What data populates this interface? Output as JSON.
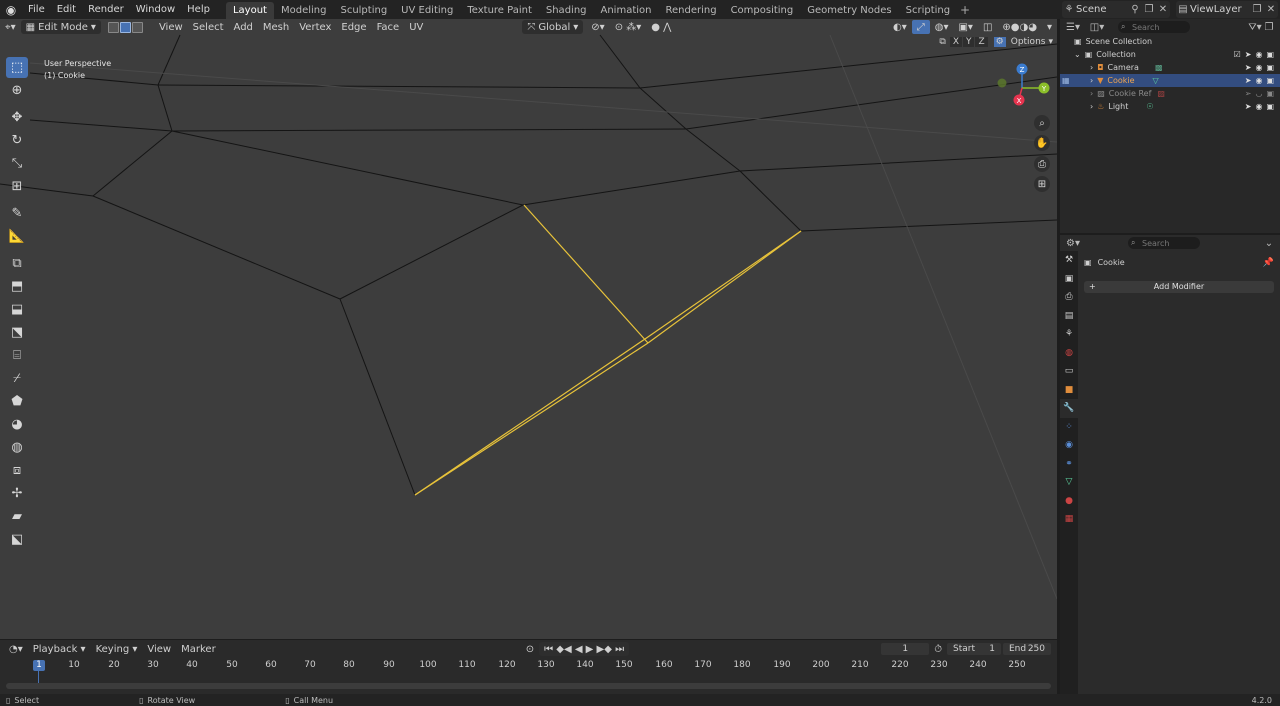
{
  "app": {
    "menu": [
      "File",
      "Edit",
      "Render",
      "Window",
      "Help"
    ],
    "workspaces": [
      "Layout",
      "Modeling",
      "Sculpting",
      "UV Editing",
      "Texture Paint",
      "Shading",
      "Animation",
      "Rendering",
      "Compositing",
      "Geometry Nodes",
      "Scripting"
    ],
    "active_workspace": "Layout",
    "scene": "Scene",
    "view_layer": "ViewLayer",
    "version": "4.2.0"
  },
  "viewport": {
    "mode": "Edit Mode",
    "menu": [
      "View",
      "Select",
      "Add",
      "Mesh",
      "Vertex",
      "Edge",
      "Face",
      "UV"
    ],
    "orientation": "Global",
    "perspective": "User Perspective",
    "object_label": "(1) Cookie",
    "options": "Options",
    "axes": [
      "X",
      "Y",
      "Z"
    ],
    "gizmo": {
      "x": "X",
      "y": "Y",
      "z": "Z"
    },
    "colors": {
      "background": "#3d3d3d",
      "edge": "#111111",
      "selected_edge": "#e8c33a",
      "active": "#4772b3"
    }
  },
  "toolbar": {
    "tools": [
      "select-box-icon",
      "cursor-icon",
      "move-icon",
      "rotate-icon",
      "scale-icon",
      "transform-icon",
      "annotate-icon",
      "measure-icon",
      "add-cube-icon",
      "extrude-icon",
      "inset-icon",
      "bevel-icon",
      "loop-cut-icon",
      "knife-icon",
      "poly-build-icon",
      "spin-icon",
      "smooth-icon",
      "edge-slide-icon",
      "shrink-fatten-icon",
      "shear-icon",
      "rip-icon"
    ]
  },
  "timeline": {
    "menu": [
      "Playback",
      "Keying",
      "View",
      "Marker"
    ],
    "current_frame": "1",
    "start_label": "Start",
    "start": "1",
    "end_label": "End",
    "end": "250",
    "ticks": [
      "10",
      "20",
      "30",
      "40",
      "50",
      "60",
      "70",
      "80",
      "90",
      "100",
      "110",
      "120",
      "130",
      "140",
      "150",
      "160",
      "170",
      "180",
      "190",
      "200",
      "210",
      "220",
      "230",
      "240",
      "250"
    ]
  },
  "outliner": {
    "search_placeholder": "Search",
    "scene_collection": "Scene Collection",
    "collection": "Collection",
    "items": [
      {
        "name": "Camera",
        "selected": false
      },
      {
        "name": "Cookie",
        "selected": true
      },
      {
        "name": "Cookie Ref",
        "selected": false
      },
      {
        "name": "Light",
        "selected": false
      }
    ]
  },
  "properties": {
    "search_placeholder": "Search",
    "object_name": "Cookie",
    "add_modifier": "Add Modifier"
  },
  "status": {
    "select": "Select",
    "rotate_view": "Rotate View",
    "call_menu": "Call Menu"
  }
}
